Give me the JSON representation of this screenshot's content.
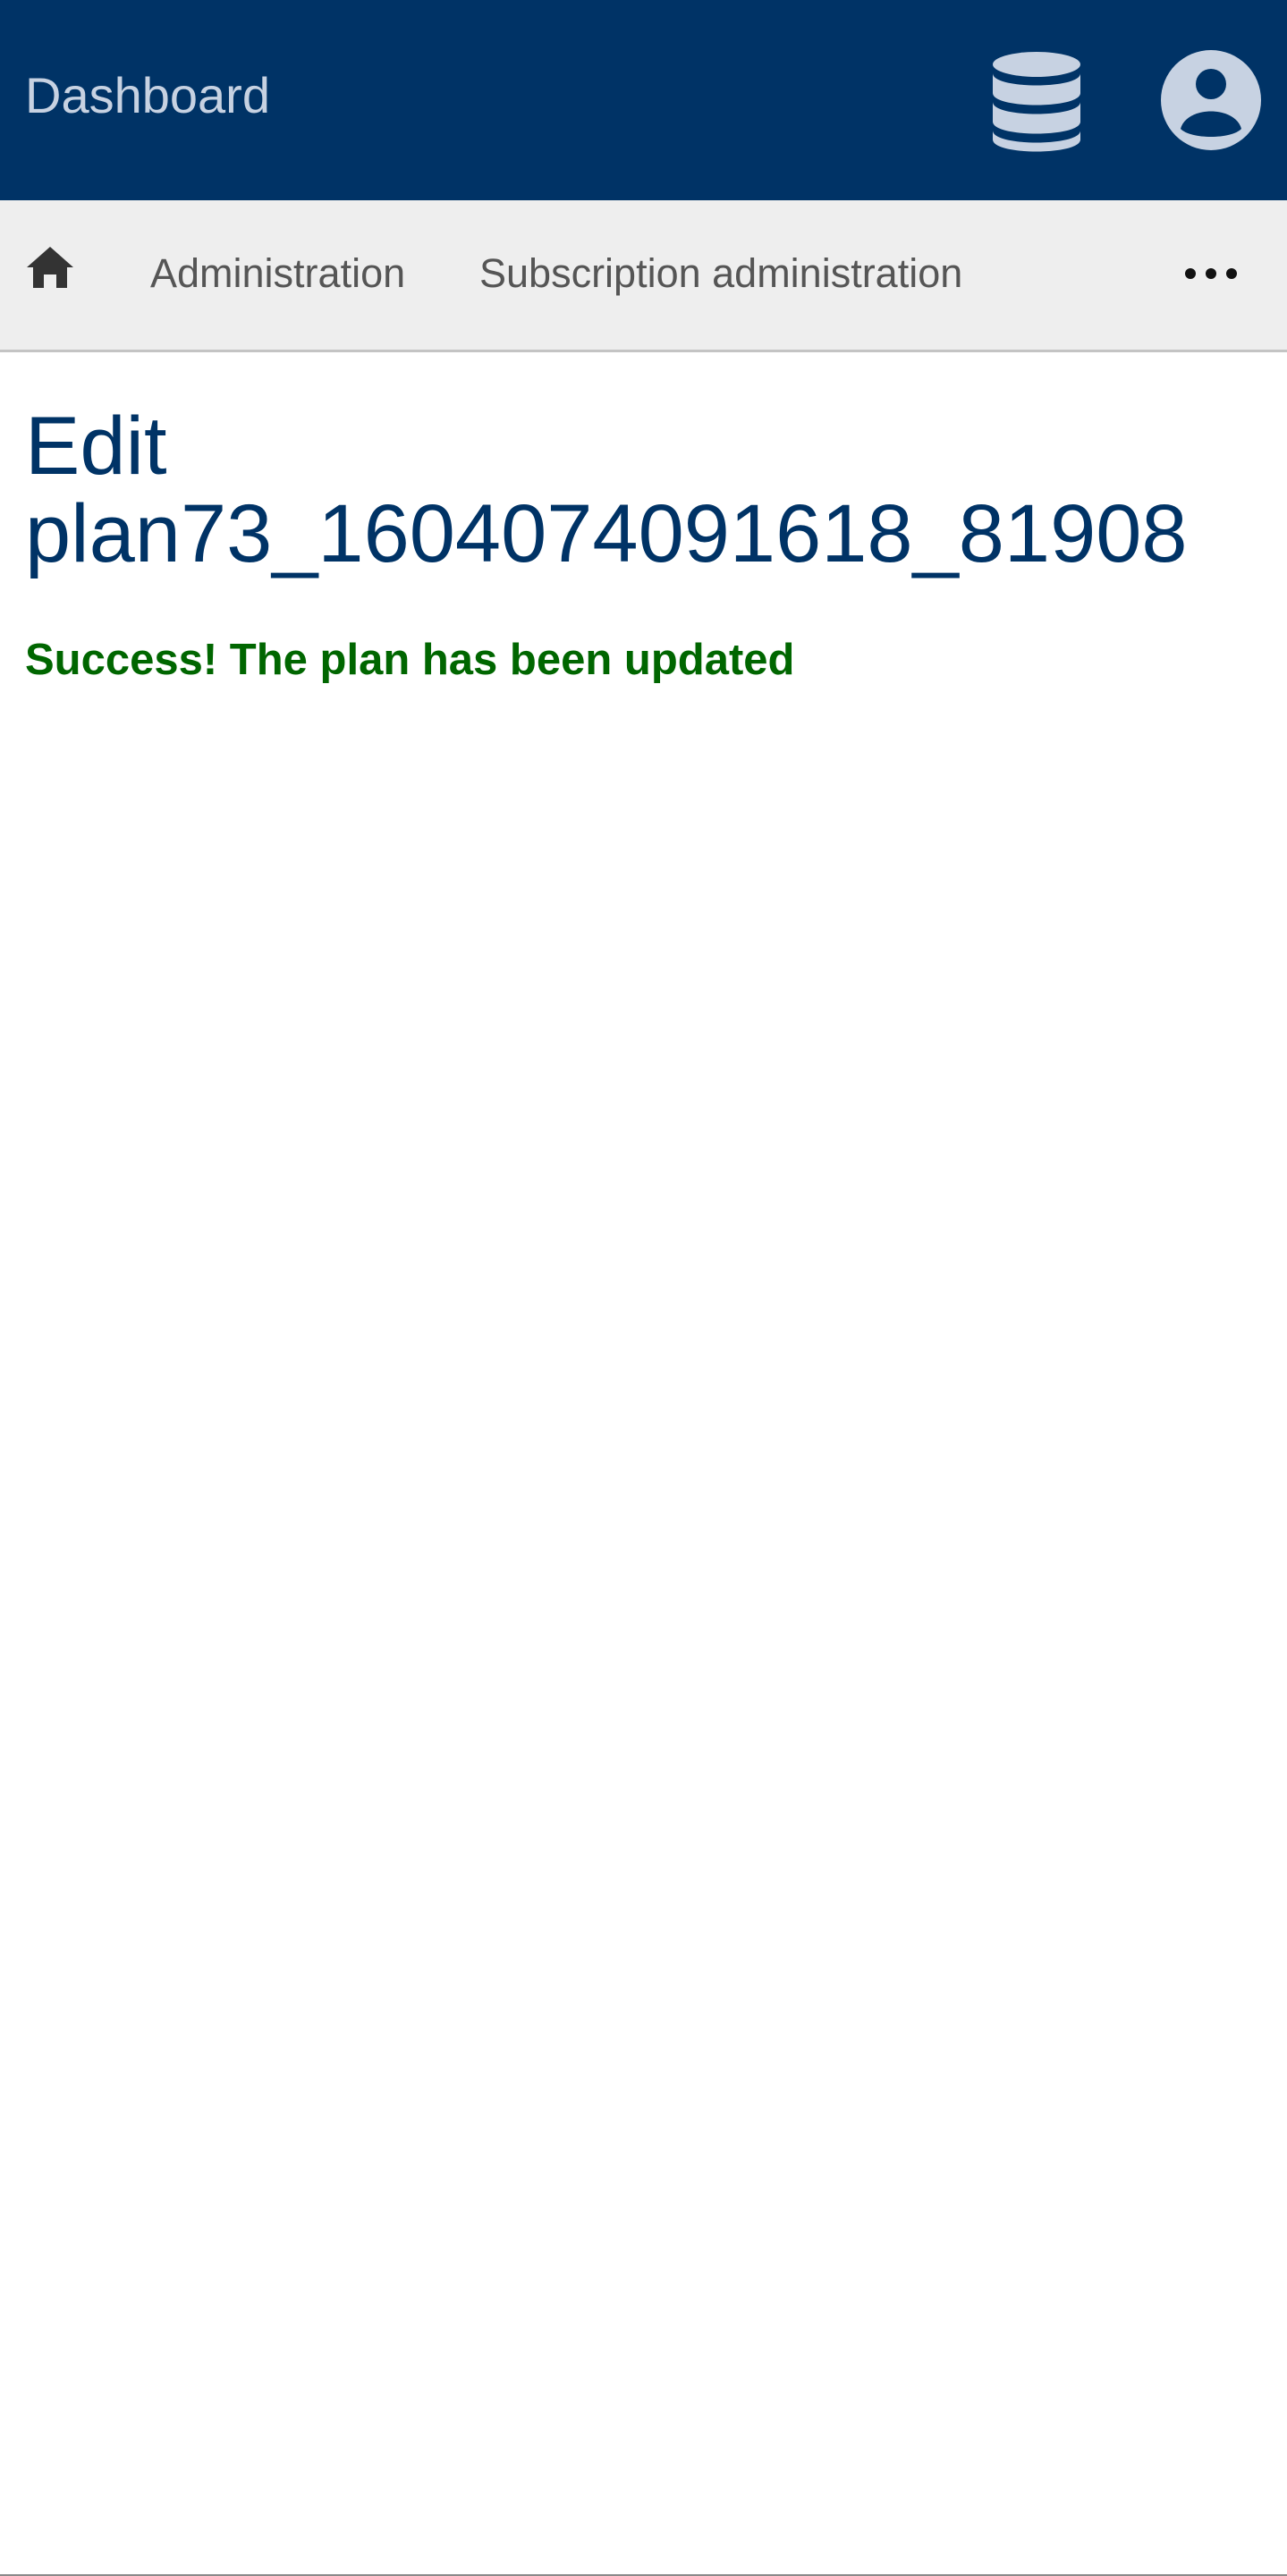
{
  "header": {
    "brand": "Dashboard",
    "background_color": "#003366",
    "icons": [
      "database-icon",
      "user-circle-icon"
    ]
  },
  "breadcrumb": {
    "home_icon": "home-icon",
    "items": [
      {
        "label": "Administration"
      },
      {
        "label": "Subscription administration"
      }
    ],
    "more_icon": "ellipsis-icon"
  },
  "main": {
    "title_line1": "Edit",
    "title_line2": "plan73_1604074091618_81908",
    "title_color": "#003366",
    "success_message": "Success! The plan has been updated",
    "success_color": "#006600"
  }
}
